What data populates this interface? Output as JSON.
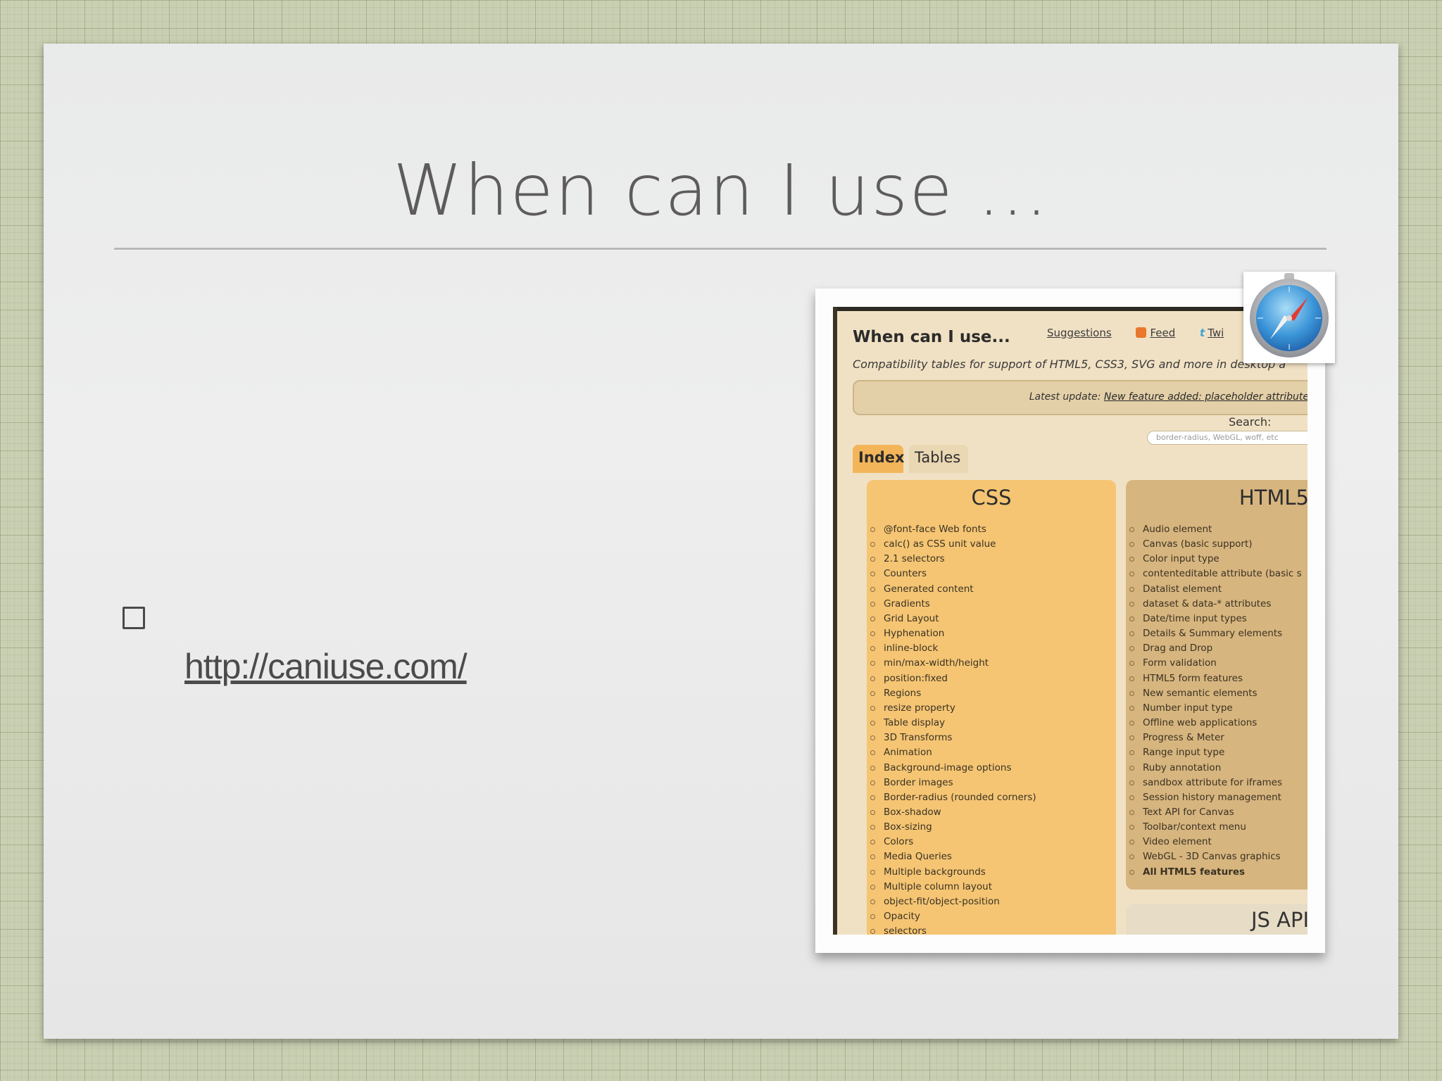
{
  "slide": {
    "title": "When can I use ...",
    "bullet_link": "http://caniuse.com/"
  },
  "screenshot": {
    "site_title": "When can I use...",
    "links": [
      "Suggestions",
      "Feed",
      "Twi"
    ],
    "tagline": "Compatibility tables for support of HTML5, CSS3, SVG and more in desktop a",
    "update_prefix": "Latest update:",
    "update_link": "New feature added: placeholder attribute",
    "search_label": "Search:",
    "search_placeholder": "border-radius, WebGL, woff, etc",
    "tabs": [
      "Index",
      "Tables"
    ],
    "css_heading": "CSS",
    "css_items": [
      "@font-face Web fonts",
      "calc() as CSS unit value",
      "2.1 selectors",
      "Counters",
      "Generated content",
      "Gradients",
      "Grid Layout",
      "Hyphenation",
      "inline-block",
      "min/max-width/height",
      "position:fixed",
      "Regions",
      "resize property",
      "Table display",
      "3D Transforms",
      "Animation",
      "Background-image options",
      "Border images",
      "Border-radius (rounded corners)",
      "Box-shadow",
      "Box-sizing",
      "Colors",
      "Media Queries",
      "Multiple backgrounds",
      "Multiple column layout",
      "object-fit/object-position",
      "Opacity",
      "selectors"
    ],
    "html5_heading": "HTML5",
    "html5_items": [
      "Audio element",
      "Canvas (basic support)",
      "Color input type",
      "contenteditable attribute (basic s",
      "Datalist element",
      "dataset & data-* attributes",
      "Date/time input types",
      "Details & Summary elements",
      "Drag and Drop",
      "Form validation",
      "HTML5 form features",
      "New semantic elements",
      "Number input type",
      "Offline web applications",
      "Progress & Meter",
      "Range input type",
      "Ruby annotation",
      "sandbox attribute for iframes",
      "Session history management",
      "Text API for Canvas",
      "Toolbar/context menu",
      "Video element",
      "WebGL - 3D Canvas graphics",
      "All HTML5 features"
    ],
    "js_heading": "JS API",
    "safari_icon": "safari-compass-icon"
  }
}
